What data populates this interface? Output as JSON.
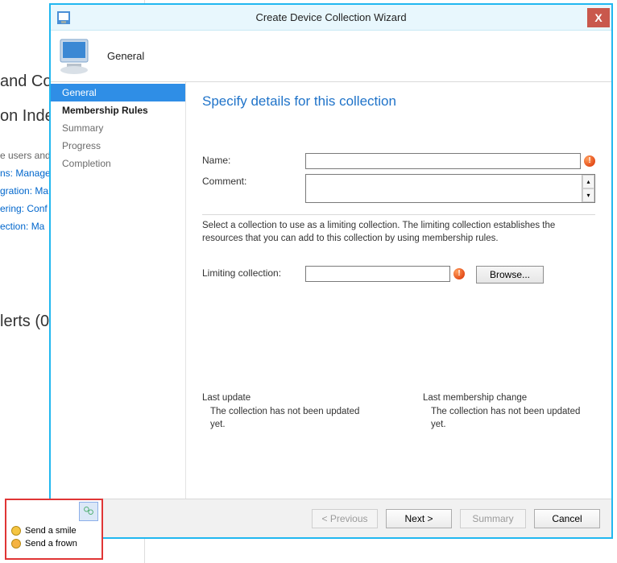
{
  "background": {
    "title_fragment": "and Co",
    "subtitle_fragment": "on Inde",
    "rows": [
      "e users and",
      "ns: Manage",
      "gration: Ma",
      "ering: Conf",
      "ection: Ma"
    ],
    "alerts_fragment": "lerts (0)"
  },
  "wizard": {
    "window_title": "Create Device Collection Wizard",
    "header": {
      "title": "General"
    },
    "nav": [
      {
        "key": "general",
        "label": "General",
        "selected": true
      },
      {
        "key": "membership",
        "label": "Membership Rules"
      },
      {
        "key": "summary",
        "label": "Summary"
      },
      {
        "key": "progress",
        "label": "Progress"
      },
      {
        "key": "completion",
        "label": "Completion"
      }
    ],
    "content": {
      "heading": "Specify details for this collection",
      "name_label": "Name:",
      "name_value": "",
      "comment_label": "Comment:",
      "comment_value": "",
      "hint": "Select a collection to use as a limiting collection. The limiting collection establishes the resources that you can add to this collection by using membership rules.",
      "limiting_label": "Limiting collection:",
      "limiting_value": "",
      "browse_label": "Browse...",
      "last_update": {
        "label": "Last update",
        "value": "The collection has not been updated yet."
      },
      "last_membership": {
        "label": "Last membership change",
        "value": "The collection has not been updated yet."
      }
    },
    "footer": {
      "previous": "< Previous",
      "next": "Next >",
      "summary": "Summary",
      "cancel": "Cancel"
    }
  },
  "feedback": {
    "smile": "Send a smile",
    "frown": "Send a frown"
  }
}
